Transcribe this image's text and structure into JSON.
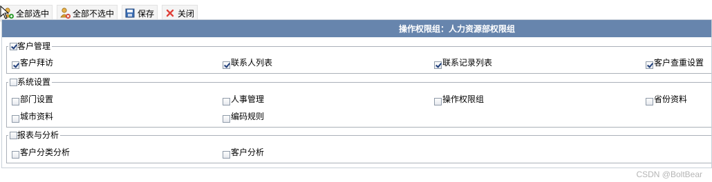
{
  "toolbar": {
    "select_all": "全部选中",
    "deselect_all": "全部不选中",
    "save": "保存",
    "close": "关闭"
  },
  "panel": {
    "title": "操作权限组：人力资源部权限组"
  },
  "groups": [
    {
      "title": "客户管理",
      "checked": true,
      "items": [
        {
          "label": "客户拜访",
          "checked": true
        },
        {
          "label": "联系人列表",
          "checked": true
        },
        {
          "label": "联系记录列表",
          "checked": true
        },
        {
          "label": "客户查重设置",
          "checked": true
        }
      ]
    },
    {
      "title": "系统设置",
      "checked": false,
      "items": [
        {
          "label": "部门设置",
          "checked": false
        },
        {
          "label": "人事管理",
          "checked": false
        },
        {
          "label": "操作权限组",
          "checked": false
        },
        {
          "label": "省份资料",
          "checked": false
        },
        {
          "label": "城市资料",
          "checked": false
        },
        {
          "label": "编码规则",
          "checked": false
        }
      ]
    },
    {
      "title": "报表与分析",
      "checked": false,
      "items": [
        {
          "label": "客户分类分析",
          "checked": false
        },
        {
          "label": "客户分析",
          "checked": false
        }
      ]
    }
  ],
  "watermark": "CSDN @BoltBear"
}
